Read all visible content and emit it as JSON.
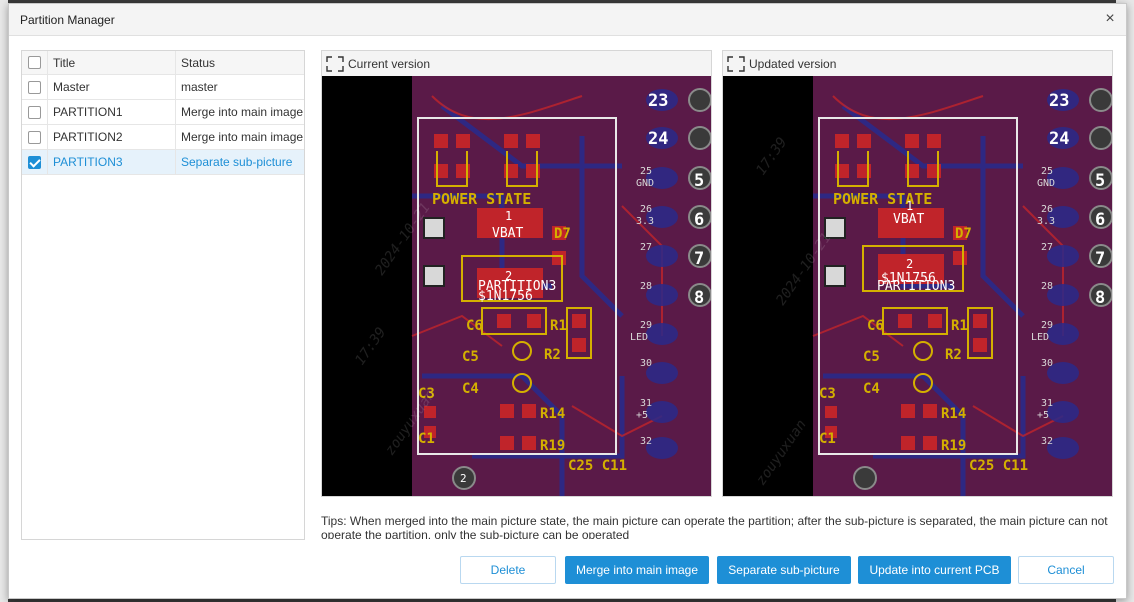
{
  "dialog": {
    "title": "Partition Manager",
    "close_glyph": "×"
  },
  "list": {
    "headers": {
      "title": "Title",
      "status": "Status"
    },
    "rows": [
      {
        "title": "Master",
        "status": "master",
        "checked": false,
        "selected": false
      },
      {
        "title": "PARTITION1",
        "status": "Merge into main image",
        "checked": false,
        "selected": false
      },
      {
        "title": "PARTITION2",
        "status": "Merge into main image",
        "checked": false,
        "selected": false
      },
      {
        "title": "PARTITION3",
        "status": "Separate sub-picture",
        "checked": true,
        "selected": true
      }
    ]
  },
  "panels": {
    "current_label": "Current version",
    "updated_label": "Updated version"
  },
  "pcb": {
    "power_state": "POWER STATE",
    "vbat_num": "1",
    "vbat": "VBAT",
    "n1756_num": "2",
    "n1756": "$1N1756",
    "partition": "PARTITION3",
    "c6": "C6",
    "c5": "C5",
    "c4": "C4",
    "c3": "C3",
    "c1": "C1",
    "r1": "R1",
    "r2": "R2",
    "r14": "R14",
    "r19": "R19",
    "c25c11": "C25 C11",
    "d7": "D7",
    "pin23": "23",
    "pin24": "24",
    "pin5": "5",
    "pin6": "6",
    "pin7": "7",
    "pin8": "8",
    "pin2": "2",
    "l25": "25",
    "gnd": "GND",
    "l26": "26",
    "v33": "3.3",
    "l27": "27",
    "l28": "28",
    "l29": "29",
    "led": "LED",
    "l30": "30",
    "l31": "31",
    "v5": "+5",
    "l32": "32",
    "watermark_date": "2024-10-21",
    "watermark_time": "17:39",
    "watermark_user": "zouyuxuan"
  },
  "tips": "Tips: When merged into the main picture state, the main picture can operate the partition; after the sub-picture is separated, the main picture can not operate the partition, only the sub-picture can be operated",
  "buttons": {
    "delete": "Delete",
    "merge": "Merge into main image",
    "separate": "Separate sub-picture",
    "update": "Update into current PCB",
    "cancel": "Cancel"
  },
  "colors": {
    "accent": "#1e8fd6",
    "pcb_bg": "#5a1a48",
    "pad_red": "#c0242a",
    "silk_yellow": "#d4b000",
    "copper_blue": "#2a2a8a"
  }
}
